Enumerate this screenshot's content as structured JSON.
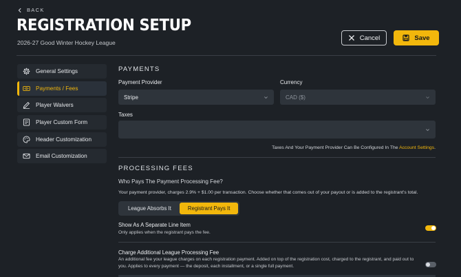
{
  "header": {
    "back_label": "BACK",
    "title": "REGISTRATION SETUP",
    "subtitle": "2026-27 Good Winter Hockey League",
    "cancel_label": "Cancel",
    "save_label": "Save"
  },
  "sidebar": {
    "items": [
      {
        "label": "General Settings",
        "icon": "gear-icon"
      },
      {
        "label": "Payments / Fees",
        "icon": "money-icon",
        "active": true
      },
      {
        "label": "Player Waivers",
        "icon": "signature-icon"
      },
      {
        "label": "Player Custom Form",
        "icon": "form-icon"
      },
      {
        "label": "Header Customization",
        "icon": "palette-icon"
      },
      {
        "label": "Email Customization",
        "icon": "email-icon"
      }
    ]
  },
  "payments": {
    "section_title": "PAYMENTS",
    "provider_label": "Payment Provider",
    "provider_value": "Stripe",
    "currency_label": "Currency",
    "currency_value": "CAD ($)",
    "taxes_label": "Taxes",
    "taxes_value": "",
    "config_note": "Taxes And Your Payment Provider Can Be Configured In The",
    "config_link": "Account Settings",
    "config_note_end": "."
  },
  "processing": {
    "section_title": "PROCESSING FEES",
    "question": "Who Pays The Payment Processing Fee?",
    "description": "Your payment provider, charges 2.9% + $1.00 per transaction. Choose whether that comes out of your payout or is added to the registrant's total.",
    "option_league": "League Absorbs It",
    "option_registrant": "Registrant Pays It",
    "selected": "Registrant Pays It",
    "line_item_title": "Show As A Separate Line Item",
    "line_item_sub": "Only applies when the registrant pays the fee.",
    "line_item_on": true,
    "additional_title": "Charge Additional League Processing Fee",
    "additional_sub": "An additional fee your league charges on each registration payment. Added on top of the registration cost, charged to the registrant, and paid out to you. Applies to every payment — the deposit, each installment, or a single full payment.",
    "additional_on": false
  },
  "colors": {
    "background": "#1d2126",
    "accent": "#f2b70c",
    "panel": "#2e343b"
  }
}
